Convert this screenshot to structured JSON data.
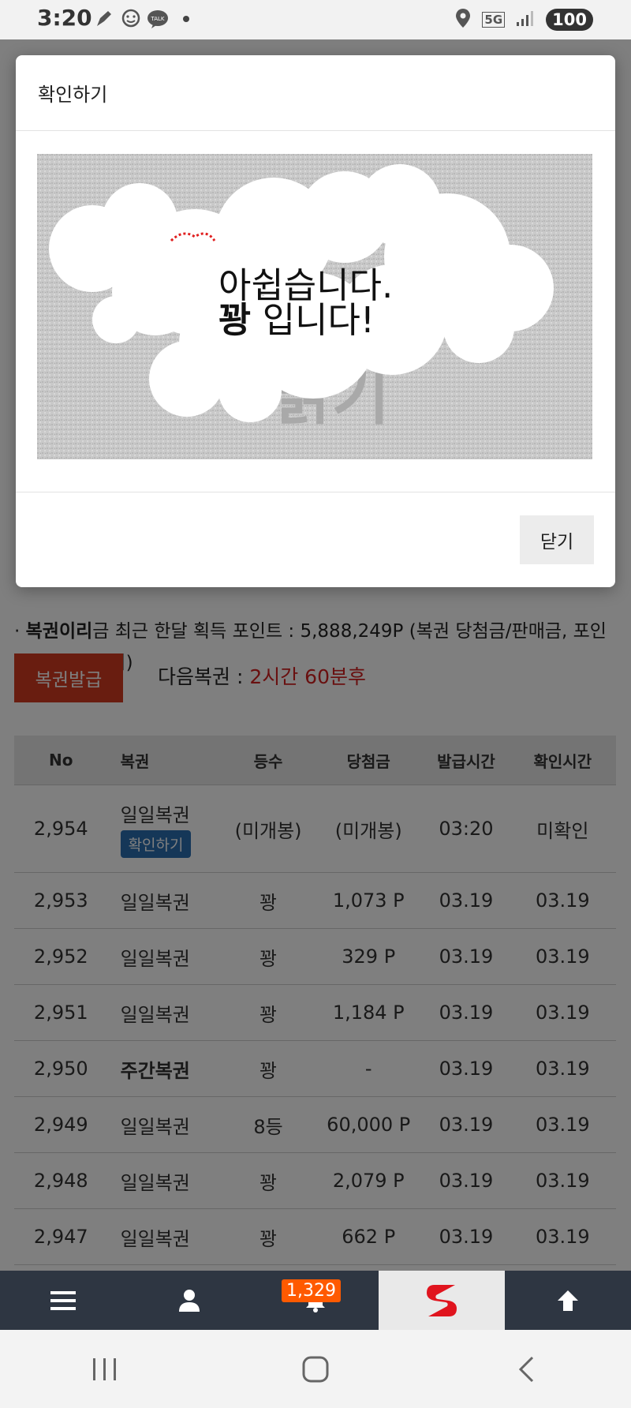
{
  "status_bar": {
    "time": "3:20",
    "left_icons": [
      "pen-icon",
      "face-badge-icon",
      "kakaotalk-icon"
    ],
    "talk_label": "TALK",
    "network": "5G",
    "battery": "100"
  },
  "modal": {
    "title": "확인하기",
    "scratch_line1": "아쉽습니다.",
    "scratch_line2_bold": "꽝",
    "scratch_line2_rest": " 입니다!",
    "scratch_bg_text": "긁기",
    "close_label": "닫기"
  },
  "page": {
    "points_text_bold": "복권이리",
    "points_text": "금 최근 한달 획득 포인트 : 5,888,249P (복권 당첨금/판매금, 포인트 바카라 제외)",
    "issue_button": "복권발급",
    "next_label": "다음복권 : ",
    "next_value": "2시간 60분후"
  },
  "table": {
    "headers": [
      "No",
      "복권",
      "등수",
      "당첨금",
      "발급시간",
      "확인시간"
    ],
    "first_row": {
      "no": "2,954",
      "name": "일일복권",
      "confirm_button": "확인하기",
      "rank": "(미개봉)",
      "prize": "(미개봉)",
      "issued": "03:20",
      "checked": "미확인"
    },
    "rows": [
      {
        "no": "2,953",
        "name": "일일복권",
        "rank": "꽝",
        "prize": "1,073 P",
        "issued": "03.19",
        "checked": "03.19"
      },
      {
        "no": "2,952",
        "name": "일일복권",
        "rank": "꽝",
        "prize": "329 P",
        "issued": "03.19",
        "checked": "03.19"
      },
      {
        "no": "2,951",
        "name": "일일복권",
        "rank": "꽝",
        "prize": "1,184 P",
        "issued": "03.19",
        "checked": "03.19"
      },
      {
        "no": "2,950",
        "name": "주간복권",
        "rank": "꽝",
        "prize": "-",
        "issued": "03.19",
        "checked": "03.19"
      },
      {
        "no": "2,949",
        "name": "일일복권",
        "rank": "8등",
        "prize": "60,000 P",
        "issued": "03.19",
        "checked": "03.19"
      },
      {
        "no": "2,948",
        "name": "일일복권",
        "rank": "꽝",
        "prize": "2,079 P",
        "issued": "03.19",
        "checked": "03.19"
      },
      {
        "no": "2,947",
        "name": "일일복권",
        "rank": "꽝",
        "prize": "662 P",
        "issued": "03.19",
        "checked": "03.19"
      }
    ]
  },
  "bottom_nav": {
    "items": [
      "menu-icon",
      "user-icon",
      "bell-icon",
      "s-logo",
      "arrow-up-icon"
    ],
    "notification_count": "1,329"
  },
  "colors": {
    "red": "#d23b21",
    "overlay": "rgba(0,0,0,0.5)",
    "nav": "#2e3642",
    "badge": "#ff5a00",
    "link_blue": "#2a6fb0"
  }
}
